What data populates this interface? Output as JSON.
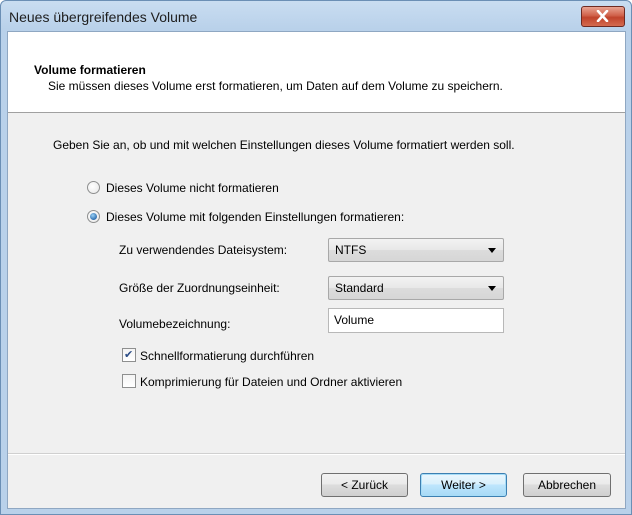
{
  "window": {
    "title": "Neues übergreifendes Volume"
  },
  "header": {
    "title": "Volume formatieren",
    "subtitle": "Sie müssen dieses Volume erst formatieren, um Daten auf dem Volume zu speichern."
  },
  "instructions": "Geben Sie an, ob und mit welchen Einstellungen dieses Volume formatiert werden soll.",
  "options": {
    "no_format": {
      "label": "Dieses Volume nicht formatieren",
      "checked": false
    },
    "format": {
      "label": "Dieses Volume mit folgenden Einstellungen formatieren:",
      "checked": true
    }
  },
  "fields": {
    "filesystem": {
      "label": "Zu verwendendes Dateisystem:",
      "value": "NTFS"
    },
    "allocation": {
      "label": "Größe der Zuordnungseinheit:",
      "value": "Standard"
    },
    "volume_label": {
      "label": "Volumebezeichnung:",
      "value": "Volume"
    }
  },
  "checkboxes": {
    "quick_format": {
      "label": "Schnellformatierung durchführen",
      "checked": true
    },
    "compression": {
      "label": "Komprimierung für Dateien und Ordner aktivieren",
      "checked": false
    }
  },
  "buttons": {
    "back": "< Zurück",
    "next": "Weiter >",
    "cancel": "Abbrechen"
  },
  "icons": {
    "close": "close-icon"
  },
  "colors": {
    "title_bar": "#b9d1ea",
    "close_button": "#c0432c",
    "dialog_bg": "#f0f0f0",
    "default_button": "#bee6fd"
  }
}
